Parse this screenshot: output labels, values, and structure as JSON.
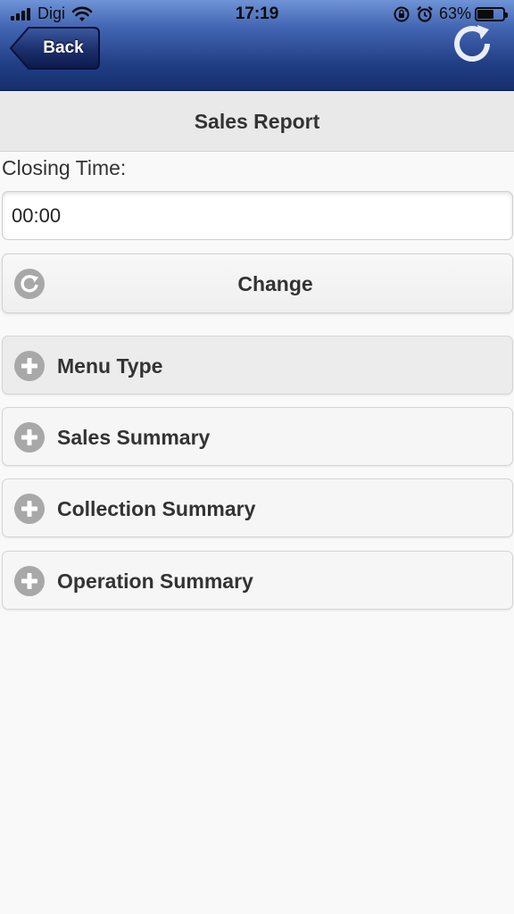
{
  "status_bar": {
    "carrier": "Digi",
    "time": "17:19",
    "battery_percent": "63%",
    "battery_level": 0.63,
    "icons": [
      "signal-icon",
      "wifi-icon",
      "screen-lock-rotation-icon",
      "alarm-icon",
      "battery-icon"
    ]
  },
  "header": {
    "back_label": "Back",
    "refresh_icon": "refresh-icon"
  },
  "page": {
    "title": "Sales Report",
    "closing_time_label": "Closing Time:",
    "closing_time_value": "00:00",
    "change_label": "Change",
    "change_icon": "refresh-icon"
  },
  "sections": [
    {
      "label": "Menu Type",
      "icon": "plus-icon"
    },
    {
      "label": "Sales Summary",
      "icon": "plus-icon"
    },
    {
      "label": "Collection Summary",
      "icon": "plus-icon"
    },
    {
      "label": "Operation Summary",
      "icon": "plus-icon"
    }
  ],
  "colors": {
    "header_top": "#6f93d6",
    "header_bottom": "#162e6e",
    "title_bar_bg": "#e9e9e9",
    "text": "#333333",
    "icon_gray": "#a8a8a8"
  }
}
